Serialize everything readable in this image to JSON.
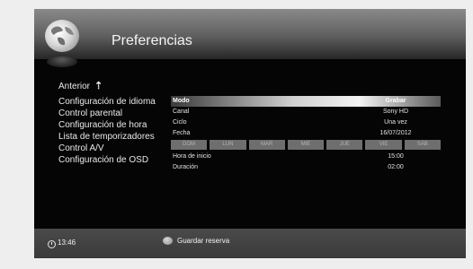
{
  "header": {
    "title": "Preferencias"
  },
  "menu": {
    "back": "Anterior",
    "items": [
      "Configuración de idioma",
      "Control parental",
      "Configuración de hora",
      "Lista de temporizadores",
      "Control A/V",
      "Configuración de OSD"
    ],
    "selected_index": 3
  },
  "details": {
    "mode": {
      "label": "Modo",
      "value": "Grabar"
    },
    "channel": {
      "label": "Canal",
      "value": "Sony HD"
    },
    "cycle": {
      "label": "Ciclo",
      "value": "Una vez"
    },
    "date": {
      "label": "Fecha",
      "value": "16/07/2012"
    },
    "days": [
      "DOM",
      "LUN",
      "MAR",
      "MIE",
      "JUE",
      "VIE",
      "SÁB"
    ],
    "start": {
      "label": "Hora de inicio",
      "value": "15:00"
    },
    "duration": {
      "label": "Duración",
      "value": "02:00"
    }
  },
  "footer": {
    "time": "13:46",
    "action": "Guardar reserva"
  },
  "icons": {
    "logo": "globe-icon",
    "back": "arrow-up-icon",
    "clock": "clock-icon",
    "button": "red-button-icon"
  }
}
